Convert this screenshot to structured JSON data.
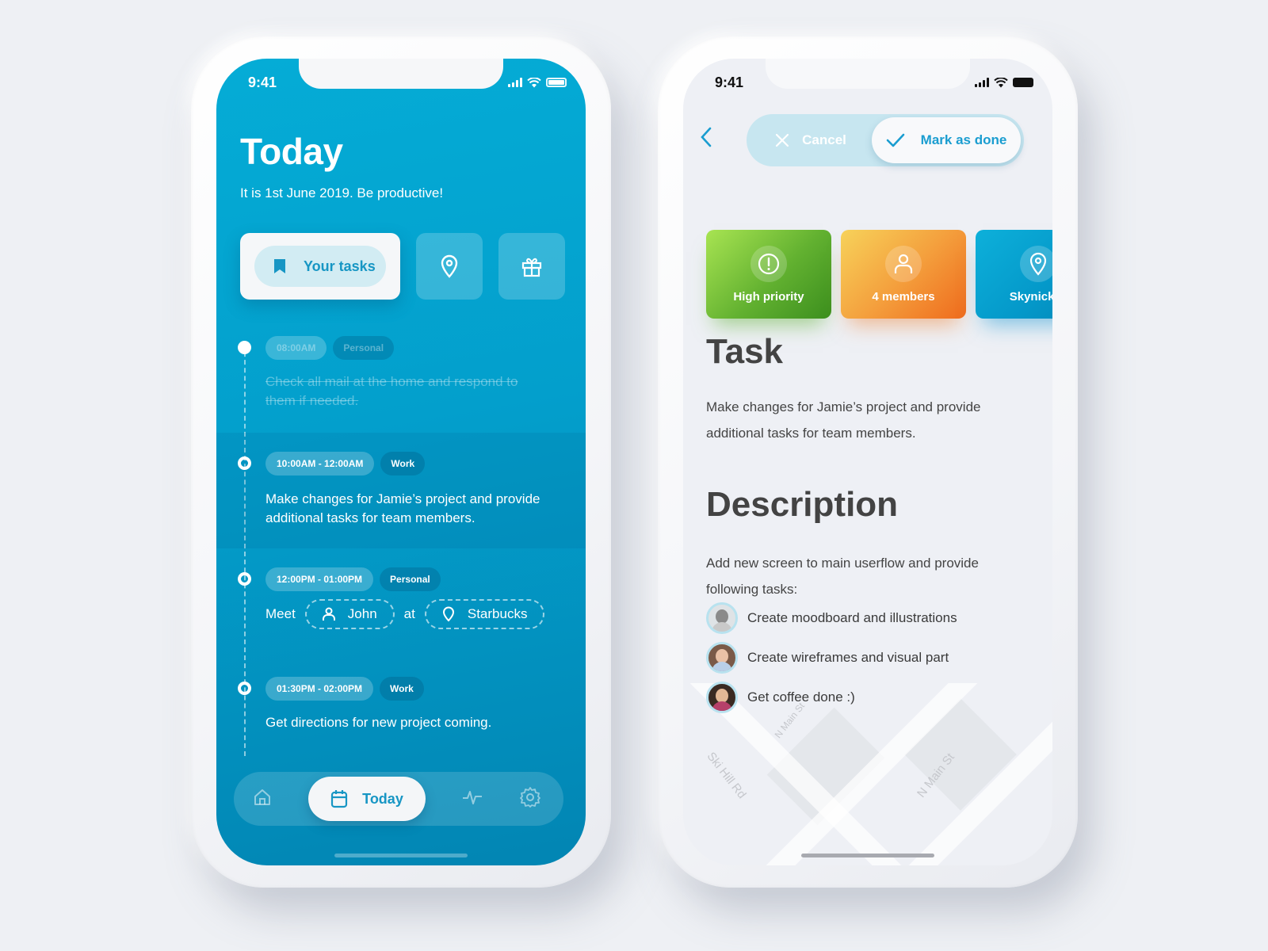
{
  "left_phone": {
    "status": {
      "time": "9:41"
    },
    "title": "Today",
    "subtitle": "It is 1st June 2019. Be productive!",
    "quick_actions": {
      "primary_label": "Your tasks",
      "primary_icon": "bookmark-icon",
      "secondary_icons": [
        "location-pin-icon",
        "gift-icon"
      ]
    },
    "timeline": [
      {
        "time": "08:00AM",
        "category": "Personal",
        "text": "Check all mail at the home and respond to them if needed.",
        "done": true
      },
      {
        "time": "10:00AM - 12:00AM",
        "category": "Work",
        "text": "Make changes for Jamie’s project and provide additional tasks for team members.",
        "done": false
      },
      {
        "time": "12:00PM - 01:00PM",
        "category": "Personal",
        "meet": {
          "prefix": "Meet",
          "person": "John",
          "joiner": "at",
          "place": "Starbucks"
        },
        "done": false
      },
      {
        "time": "01:30PM - 02:00PM",
        "category": "Work",
        "text": "Get directions for new project coming.",
        "done": false
      }
    ],
    "bottom_nav": {
      "items": [
        {
          "icon": "home-icon",
          "label": ""
        },
        {
          "icon": "calendar-icon",
          "label": "Today",
          "active": true
        },
        {
          "icon": "activity-icon",
          "label": ""
        },
        {
          "icon": "settings-gear-icon",
          "label": ""
        }
      ]
    }
  },
  "right_phone": {
    "status": {
      "time": "9:41"
    },
    "actions": {
      "cancel_label": "Cancel",
      "done_label": "Mark as done"
    },
    "meta_cards": [
      {
        "label": "High priority",
        "icon": "alert-circle-icon",
        "color": "#62b130"
      },
      {
        "label": "4 members",
        "icon": "user-icon",
        "color": "#f4a13e"
      },
      {
        "label": "Skynick O",
        "icon": "location-pin-icon",
        "color": "#0498c9"
      }
    ],
    "task_heading": "Task",
    "task_text": "Make changes for Jamie’s project and provide additional tasks for team members.",
    "description_heading": "Description",
    "description_text": "Add new screen to main userflow and provide following tasks:",
    "subtasks": [
      {
        "text": "Create moodboard and illustrations"
      },
      {
        "text": "Create wireframes and visual part"
      },
      {
        "text": "Get coffee done :)"
      }
    ],
    "map_labels": [
      "Ski Hill Rd",
      "N Main St",
      "N Main St"
    ]
  },
  "colors": {
    "accent_blue": "#1a9dd0",
    "screen_blue": "#039fcc",
    "text_dark": "#434343"
  }
}
